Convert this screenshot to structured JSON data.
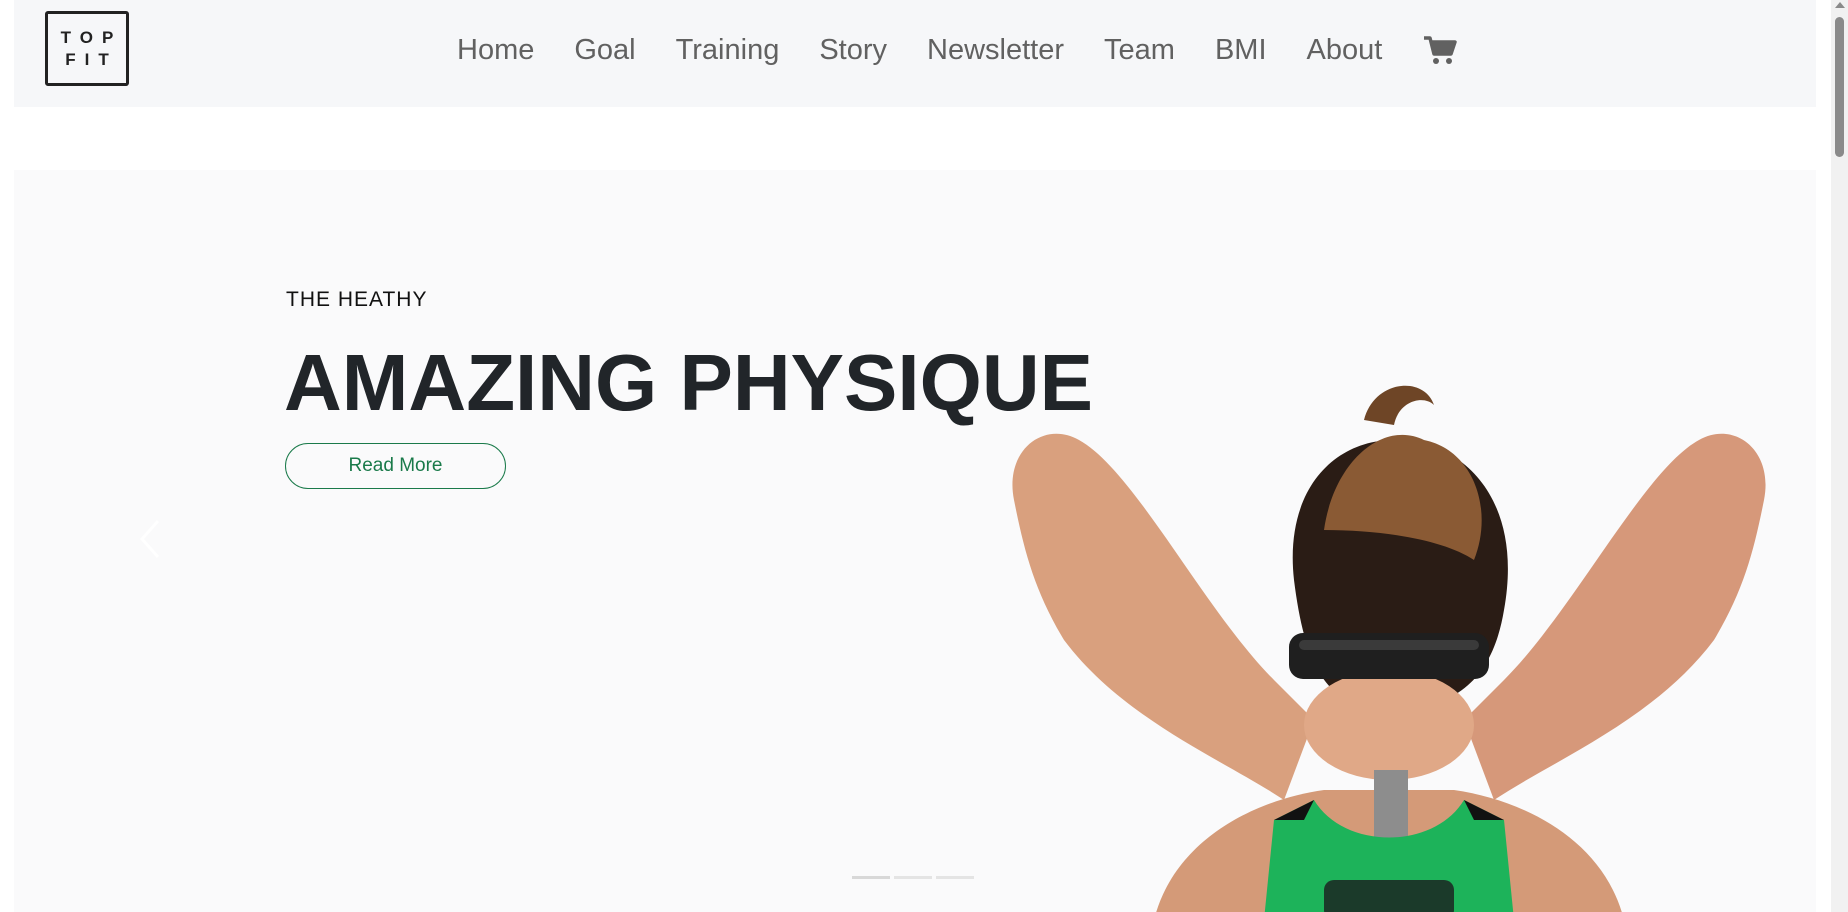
{
  "header": {
    "logo": {
      "line1": "TOP",
      "line2": "FIT"
    },
    "nav": [
      "Home",
      "Goal",
      "Training",
      "Story",
      "Newsletter",
      "Team",
      "BMI",
      "About"
    ],
    "cart_icon": "shopping-cart-icon"
  },
  "hero": {
    "kicker": "THE HEATHY",
    "title": "AMAZING PHYSIQUE",
    "cta_label": "Read More",
    "prev_icon": "chevron-left-icon",
    "next_icon": "chevron-right-icon",
    "slide_count": 3,
    "active_slide": 1,
    "accent_color": "#1a7a4a",
    "image": "woman-lifting-dumbbell-behind-head"
  }
}
